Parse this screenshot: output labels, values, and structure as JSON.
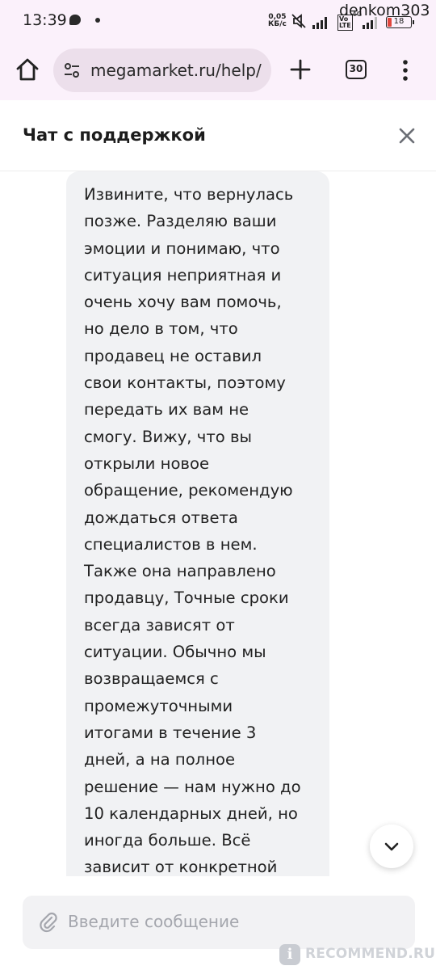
{
  "status_bar": {
    "time": "13:39",
    "speed": "0,05\nКБ/с",
    "battery": "18",
    "network": "4G",
    "lte": "Vo\nLTE"
  },
  "overlay_user": "denkom303",
  "browser": {
    "url": "megamarket.ru/help/",
    "tab_count": "30"
  },
  "chat": {
    "title": "Чат с поддержкой",
    "messages": [
      {
        "sender": "support",
        "text": "Извините, что вернулась\nпозже. Разделяю ваши\nэмоции и понимаю, что\nситуация неприятная и\nочень хочу вам помочь,\nно дело в том, что\nпродавец не оставил\nсвои контакты, поэтому\nпередать их вам не\nсмогу. Вижу, что вы\nоткрыли новое\nобращение, рекомендую\nдождаться ответа\nспециалистов в нем.\nТакже она направлено\nпродавцу, Точные сроки\nвсегда зависят от\nситуации. Обычно мы\nвозвращаемся с\nпромежуточными\nитогами в течение 3\nдней, а на полное\nрешение — нам нужно до\n10 календарных дней, но\nиногда больше. Всё\nзависит от конкретной"
      }
    ],
    "input_placeholder": "Введите сообщение"
  },
  "watermark": {
    "badge": "i",
    "text": "RECOMMEND.RU"
  },
  "colors": {
    "browser_bg": "#fbf1fb",
    "url_box": "#ecdfeb",
    "bubble": "#f1f2f4",
    "input_bg": "#f2f2f4",
    "placeholder": "#a4a6ad"
  },
  "icons": [
    "chat-notification-icon",
    "mute-icon",
    "signal-icon",
    "battery-icon",
    "home-icon",
    "site-settings-icon",
    "plus-icon",
    "tabs-icon",
    "more-vert-icon",
    "close-icon",
    "chevron-down-icon",
    "paperclip-icon"
  ]
}
